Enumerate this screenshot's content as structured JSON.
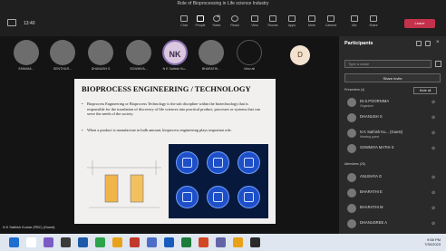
{
  "window": {
    "title": "Role of Bioprocessing in Life science Industry",
    "timer": "13:40"
  },
  "toolbar": {
    "items": [
      {
        "label": "Chat",
        "icon": "chat-icon"
      },
      {
        "label": "People",
        "icon": "people-icon",
        "badge": "35"
      },
      {
        "label": "Raise",
        "icon": "raise-hand-icon"
      },
      {
        "label": "React",
        "icon": "react-icon"
      },
      {
        "label": "View",
        "icon": "view-icon"
      },
      {
        "label": "Rooms",
        "icon": "rooms-icon"
      },
      {
        "label": "Apps",
        "icon": "apps-icon"
      },
      {
        "label": "More",
        "icon": "more-icon"
      },
      {
        "label": "Camera",
        "icon": "camera-icon"
      },
      {
        "label": "Mic",
        "icon": "mic-icon"
      },
      {
        "label": "Share",
        "icon": "share-icon"
      }
    ],
    "leave": "Leave"
  },
  "participants_strip": [
    {
      "name": "EMMANI..."
    },
    {
      "name": "SENTHILR..."
    },
    {
      "name": "DHANUSH S"
    },
    {
      "name": "SOWMIYA..."
    },
    {
      "name": "N K Sathish Ku...",
      "initials": "NK"
    },
    {
      "name": "BHARATHI..."
    },
    {
      "name": "View all"
    }
  ],
  "video_tile": {
    "initial": "D"
  },
  "slide": {
    "title": "BIOPROCESS ENGINEERING / TECHNOLOGY",
    "bullet1": "Bioprocess Engineering or Bioprocess Technology is the sub discipline within the biotechnology that is responsible for the translation of discovery of life sciences into practical product, processes or systems that can serve the needs of the society.",
    "bullet2": "When a product is manufacture in bulk amount, bioprocess engineering plays important role."
  },
  "speaker_label": "N K Sathish Kumar (PBC) (Guest)",
  "panel": {
    "title": "Participants",
    "search_placeholder": "Type a name",
    "share_invite": "Share invite",
    "presenters_label": "Presenters (4)",
    "mute_all": "Mute all",
    "presenters": [
      {
        "name": "Dr.S.POORNIMA",
        "sub": "Organiser"
      },
      {
        "name": "DHANUSH S",
        "sub": ""
      },
      {
        "name": "N K Sathish Ku...  (Guest)",
        "sub": "Meeting guest"
      },
      {
        "name": "SOWMIYA MATHI S",
        "sub": ""
      }
    ],
    "attendees_label": "Attendees (25)",
    "attendees": [
      {
        "name": "ANUSHYA G"
      },
      {
        "name": "BHARATHI E"
      },
      {
        "name": "BHARATHI M"
      },
      {
        "name": "DHANUSREE A"
      }
    ]
  },
  "taskbar": {
    "time": "9:58 PM",
    "date": "7/30/2023"
  },
  "colors": {
    "leave": "#c4314b",
    "panel": "#2a2a2a",
    "slide_panel": "#071a3e",
    "circle": "#1e4fc8"
  }
}
